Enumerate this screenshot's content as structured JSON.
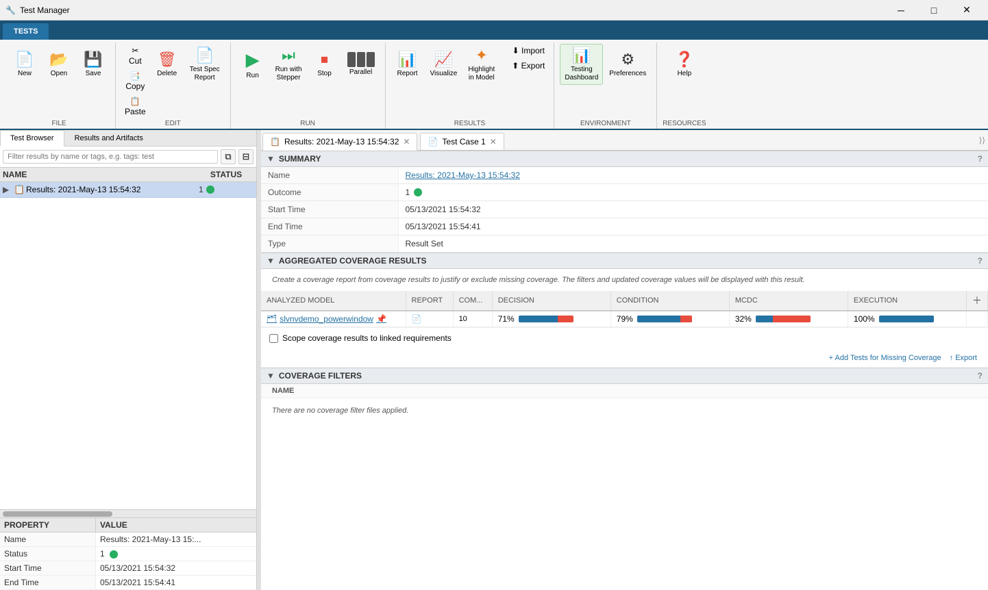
{
  "window": {
    "title": "Test Manager",
    "minimize_label": "─",
    "maximize_label": "□",
    "close_label": "✕"
  },
  "app_tab": {
    "label": "TESTS"
  },
  "ribbon": {
    "groups": [
      {
        "label": "FILE",
        "buttons": [
          {
            "id": "new",
            "label": "New",
            "icon": "📄",
            "icon_color": ""
          },
          {
            "id": "open",
            "label": "Open",
            "icon": "📂",
            "icon_color": ""
          },
          {
            "id": "save",
            "label": "Save",
            "icon": "💾",
            "icon_color": ""
          }
        ]
      },
      {
        "label": "EDIT",
        "buttons": [
          {
            "id": "cut",
            "label": "Cut",
            "icon": "✂",
            "icon_color": ""
          },
          {
            "id": "paste",
            "label": "Paste",
            "icon": "📋",
            "icon_color": ""
          },
          {
            "id": "copy",
            "label": "Copy",
            "icon": "📑",
            "icon_color": ""
          },
          {
            "id": "delete",
            "label": "Delete",
            "icon": "🗑",
            "icon_color": "red"
          },
          {
            "id": "test-spec-report",
            "label": "Test Spec\nReport",
            "icon": "📄",
            "icon_color": ""
          }
        ]
      },
      {
        "label": "RUN",
        "buttons": [
          {
            "id": "run",
            "label": "Run",
            "icon": "▶",
            "icon_color": "green"
          },
          {
            "id": "run-with-stepper",
            "label": "Run with\nStepper",
            "icon": "⏭",
            "icon_color": "green"
          },
          {
            "id": "stop",
            "label": "Stop",
            "icon": "⏹",
            "icon_color": "red"
          },
          {
            "id": "parallel",
            "label": "Parallel",
            "icon": "⬛⬛",
            "icon_color": ""
          }
        ]
      },
      {
        "label": "RESULTS",
        "buttons": [
          {
            "id": "report",
            "label": "Report",
            "icon": "📊",
            "icon_color": ""
          },
          {
            "id": "visualize",
            "label": "Visualize",
            "icon": "📈",
            "icon_color": ""
          },
          {
            "id": "highlight-in-model",
            "label": "Highlight\nin Model",
            "icon": "🔆",
            "icon_color": ""
          },
          {
            "id": "import",
            "label": "Import",
            "icon": "⬇",
            "icon_color": ""
          },
          {
            "id": "export",
            "label": "Export",
            "icon": "⬆",
            "icon_color": ""
          }
        ]
      },
      {
        "label": "ENVIRONMENT",
        "buttons": [
          {
            "id": "testing-dashboard",
            "label": "Testing\nDashboard",
            "icon": "📊",
            "icon_color": "dark-green"
          },
          {
            "id": "preferences",
            "label": "Preferences",
            "icon": "⚙",
            "icon_color": ""
          }
        ]
      },
      {
        "label": "RESOURCES",
        "buttons": [
          {
            "id": "help",
            "label": "Help",
            "icon": "❓",
            "icon_color": ""
          }
        ]
      }
    ]
  },
  "left_panel": {
    "tabs": [
      {
        "id": "test-browser",
        "label": "Test Browser",
        "active": true
      },
      {
        "id": "results-artifacts",
        "label": "Results and Artifacts",
        "active": false
      }
    ],
    "filter_placeholder": "Filter results by name or tags, e.g. tags: test",
    "tree_columns": {
      "name": "NAME",
      "status": "STATUS"
    },
    "tree_items": [
      {
        "id": "results-2021",
        "label": "Results: 2021-May-13 15:54:32",
        "status_num": "1",
        "status_color": "green",
        "expanded": false
      }
    ],
    "properties": {
      "header_property": "PROPERTY",
      "header_value": "VALUE",
      "rows": [
        {
          "key": "Name",
          "value": "Results: 2021-May-13 15:..."
        },
        {
          "key": "Status",
          "value": "1",
          "is_status": true
        },
        {
          "key": "Start Time",
          "value": "05/13/2021 15:54:32"
        },
        {
          "key": "End Time",
          "value": "05/13/2021 15:54:41"
        }
      ]
    }
  },
  "content_tabs": [
    {
      "id": "results-tab",
      "label": "Results: 2021-May-13 15:54:32",
      "active": true,
      "closeable": true
    },
    {
      "id": "test-case-tab",
      "label": "Test Case 1",
      "active": false,
      "closeable": true
    }
  ],
  "summary_section": {
    "title": "SUMMARY",
    "rows": [
      {
        "key": "Name",
        "value": "Results: 2021-May-13 15:54:32",
        "is_link": true
      },
      {
        "key": "Outcome",
        "value": "1",
        "is_outcome": true
      },
      {
        "key": "Start Time",
        "value": "05/13/2021 15:54:32"
      },
      {
        "key": "End Time",
        "value": "05/13/2021 15:54:41"
      },
      {
        "key": "Type",
        "value": "Result Set"
      }
    ]
  },
  "coverage_section": {
    "title": "AGGREGATED COVERAGE RESULTS",
    "note": "Create a coverage report from coverage results to justify or exclude missing coverage. The filters and updated coverage values will be displayed with this result.",
    "columns": [
      "ANALYZED MODEL",
      "REPORT",
      "COM...",
      "DECISION",
      "CONDITION",
      "MCDC",
      "EXECUTION"
    ],
    "rows": [
      {
        "model": "slvnvdemo_powerwindow",
        "report_icon": true,
        "pin_icon": true,
        "com": "10",
        "decision": "71%",
        "decision_blue_pct": 71,
        "decision_red_pct": 29,
        "condition": "79%",
        "condition_blue_pct": 79,
        "condition_red_pct": 21,
        "mcdc": "32%",
        "mcdc_blue_pct": 32,
        "mcdc_red_pct": 68,
        "execution": "100%",
        "execution_blue_pct": 100,
        "execution_red_pct": 0
      }
    ],
    "scope_label": "Scope coverage results to linked requirements",
    "add_tests_label": "+ Add Tests for Missing Coverage",
    "export_label": "↑ Export"
  },
  "filters_section": {
    "title": "COVERAGE FILTERS",
    "name_header": "NAME",
    "empty_message": "There are no coverage filter files applied."
  }
}
